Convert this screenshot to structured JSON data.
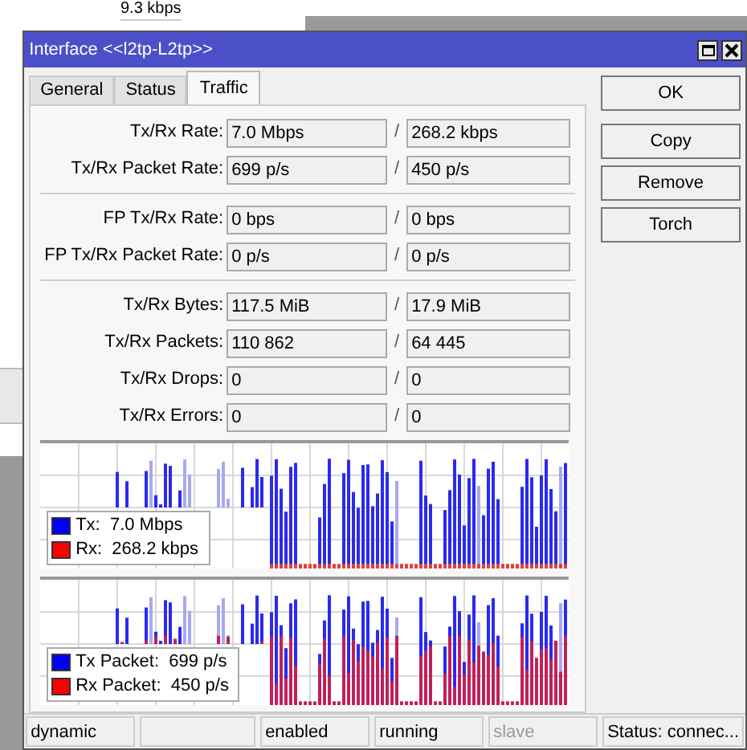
{
  "background": {
    "reading": "9.3 kbps"
  },
  "window": {
    "title": "Interface <<l2tp-L2tp>>"
  },
  "tabs": [
    {
      "label": "General",
      "selected": false
    },
    {
      "label": "Status",
      "selected": false
    },
    {
      "label": "Traffic",
      "selected": true
    }
  ],
  "sections": [
    {
      "rows": [
        {
          "label": "Tx/Rx Rate:",
          "tx": "7.0 Mbps",
          "separator": "/",
          "rx": "268.2 kbps"
        },
        {
          "label": "Tx/Rx Packet Rate:",
          "tx": "699 p/s",
          "separator": "/",
          "rx": "450 p/s"
        }
      ]
    },
    {
      "rows": [
        {
          "label": "FP Tx/Rx Rate:",
          "tx": "0 bps",
          "separator": "/",
          "rx": "0 bps"
        },
        {
          "label": "FP Tx/Rx Packet Rate:",
          "tx": "0 p/s",
          "separator": "/",
          "rx": "0 p/s"
        }
      ]
    },
    {
      "rows": [
        {
          "label": "Tx/Rx Bytes:",
          "tx": "117.5 MiB",
          "separator": "/",
          "rx": "17.9 MiB"
        },
        {
          "label": "Tx/Rx Packets:",
          "tx": "110 862",
          "separator": "/",
          "rx": "64 445"
        },
        {
          "label": "Tx/Rx Drops:",
          "tx": "0",
          "separator": "/",
          "rx": "0"
        },
        {
          "label": "Tx/Rx Errors:",
          "tx": "0",
          "separator": "/",
          "rx": "0"
        }
      ]
    }
  ],
  "graphs": [
    {
      "legend": [
        {
          "text": "Tx:  7.0 Mbps",
          "color": "#0000ff"
        },
        {
          "text": "Rx:  268.2 kbps",
          "color": "#ff0000"
        }
      ]
    },
    {
      "legend": [
        {
          "text": "Tx Packet:  699 p/s",
          "color": "#0000ff"
        },
        {
          "text": "Rx Packet:  450 p/s",
          "color": "#ff0000"
        }
      ]
    }
  ],
  "buttons": [
    "OK",
    "Copy",
    "Remove",
    "Torch"
  ],
  "status_bar": [
    {
      "text": "dynamic",
      "disabled": false
    },
    {
      "text": "enabled",
      "disabled": false
    },
    {
      "text": "running",
      "disabled": false
    },
    {
      "text": "slave",
      "disabled": true
    },
    {
      "text": "Status: connec...",
      "disabled": false
    }
  ]
}
